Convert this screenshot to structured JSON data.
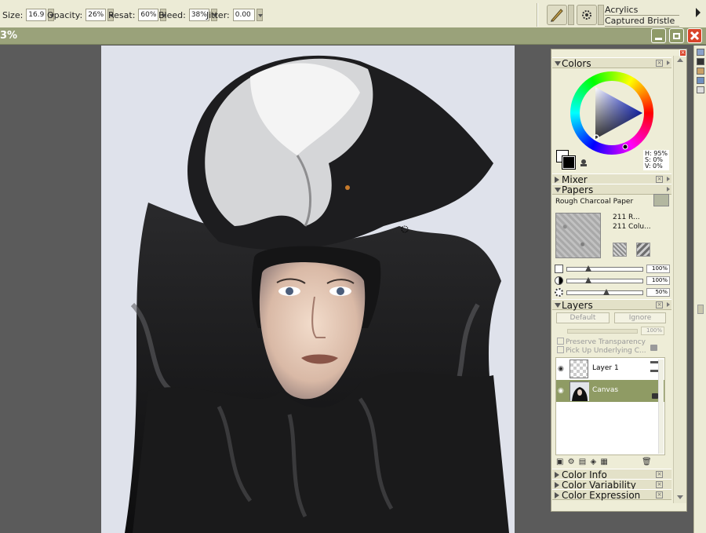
{
  "toolbar": {
    "size_label": "Size:",
    "size_value": "16.9",
    "opacity_label": "Opacity:",
    "opacity_value": "26%",
    "resat_label": "Resat:",
    "resat_value": "60%",
    "bleed_label": "Bleed:",
    "bleed_value": "38%",
    "jitter_label": "Jitter:",
    "jitter_value": "0.00",
    "brush_category": "Acrylics",
    "brush_variant": "Captured Bristle"
  },
  "document": {
    "zoom": "3%"
  },
  "palette": {
    "colors": {
      "title": "Colors",
      "hue_value": "H: 95%",
      "sat_value": "S: 0%",
      "val_value": "V: 0%",
      "main_color": "#000000",
      "secondary_color": "#ffffff"
    },
    "mixer": {
      "title": "Mixer"
    },
    "papers": {
      "title": "Papers",
      "paper_name": "Rough Charcoal Paper",
      "info_line1": "211 R...",
      "info_line2": "211 Colu...",
      "sliders": [
        {
          "name": "scale",
          "value": "100%",
          "fraction": 0.25
        },
        {
          "name": "contrast",
          "value": "100%",
          "fraction": 0.25
        },
        {
          "name": "brightness",
          "value": "50%",
          "fraction": 0.5
        }
      ]
    },
    "layers": {
      "title": "Layers",
      "composite_method": "Default",
      "composite_depth": "Ignore",
      "opacity": "100%",
      "preserve_transparency": "Preserve Transparency",
      "pick_up_underlying": "Pick Up Underlying C...",
      "items": [
        {
          "name": "Layer 1",
          "selected": false
        },
        {
          "name": "Canvas",
          "selected": true
        }
      ]
    },
    "collapsed": [
      {
        "title": "Color Info"
      },
      {
        "title": "Color Variability"
      },
      {
        "title": "Color Expression"
      }
    ]
  },
  "colors_accent": {
    "panel_bg": "#eeedd7",
    "title_bar": "#9aa27a",
    "selected_layer": "#8f9b64",
    "close_red": "#d9442a"
  }
}
